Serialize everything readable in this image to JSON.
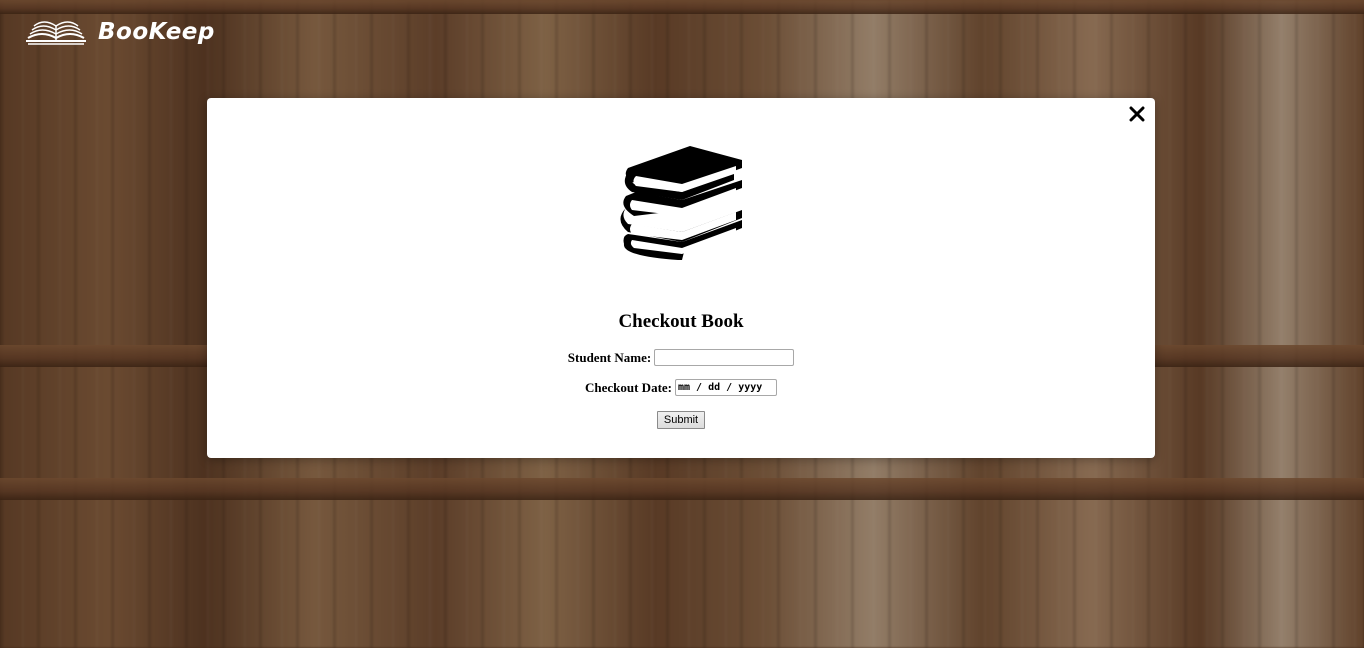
{
  "app": {
    "logo_text": "BooKeep",
    "logo_icon": "open-book-icon"
  },
  "modal": {
    "close_icon": "close-icon",
    "hero_icon": "books-stack-icon",
    "title": "Checkout Book",
    "fields": {
      "student_name_label": "Student Name:",
      "student_name_value": "",
      "checkout_date_label": "Checkout Date:",
      "checkout_date_placeholder": "mm / dd / yyyy"
    },
    "submit_label": "Submit"
  },
  "colors": {
    "modal_background": "#ffffff",
    "icon_color": "#000000",
    "logo_text_color": "#ffffff"
  }
}
